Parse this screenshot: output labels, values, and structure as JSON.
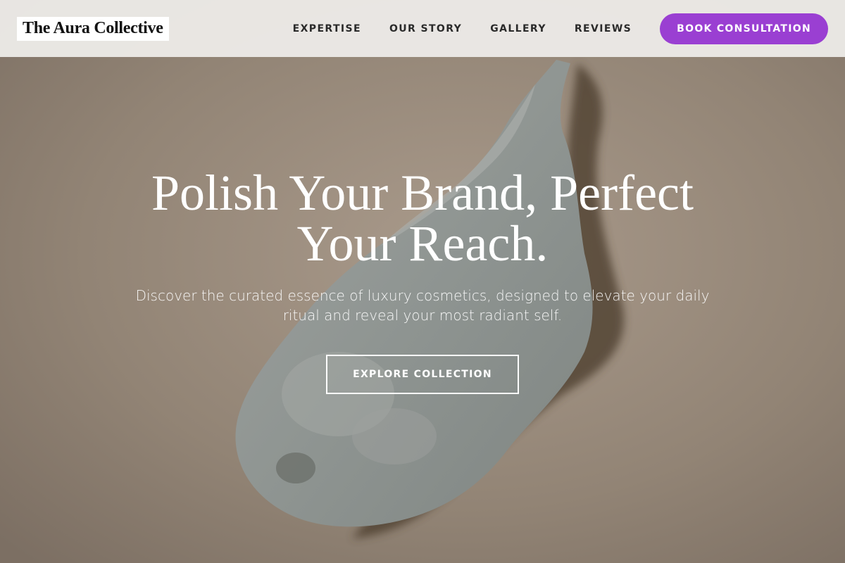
{
  "header": {
    "logo_text": "The Aura Collective",
    "nav": [
      {
        "label": "EXPERTISE"
      },
      {
        "label": "OUR STORY"
      },
      {
        "label": "GALLERY"
      },
      {
        "label": "REVIEWS"
      }
    ],
    "cta_label": "BOOK CONSULTATION"
  },
  "hero": {
    "title": "Polish Your Brand, Perfect Your Reach.",
    "subtitle": "Discover the curated essence of luxury cosmetics, designed to elevate your daily ritual and reveal your most radiant self.",
    "button_label": "EXPLORE COLLECTION",
    "background_image": "cream-swatch-photo"
  },
  "colors": {
    "accent": "#9a3fd2",
    "header_bg": "#eceae7",
    "hero_overlay": "#8c7e70",
    "text_on_hero": "#ffffff"
  }
}
